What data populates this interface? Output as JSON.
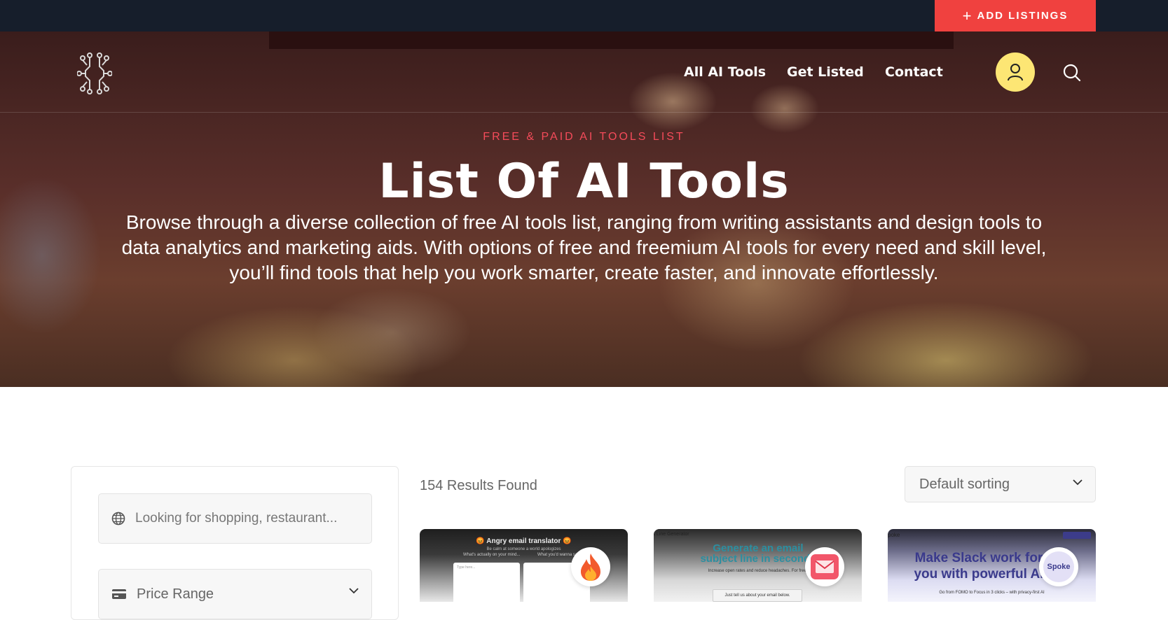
{
  "topbar": {
    "add_listings_label": "ADD LISTINGS"
  },
  "nav": {
    "items": [
      {
        "label": "All AI Tools"
      },
      {
        "label": "Get Listed"
      },
      {
        "label": "Contact"
      }
    ]
  },
  "hero": {
    "eyebrow": "FREE & PAID AI TOOLS LIST",
    "title": "List Of AI Tools",
    "description": "Browse through a diverse collection of free AI tools list, ranging from writing assistants and design tools to data analytics and marketing aids. With options of free and freemium AI tools for every need and skill level, you’ll find tools that help you work smarter, create faster, and innovate effortlessly."
  },
  "filters": {
    "search_placeholder": "Looking for shopping, restaurant...",
    "price_range_label": "Price Range"
  },
  "listing": {
    "results_text": "154 Results Found",
    "sorting_value": "Default sorting"
  },
  "cards": [
    {
      "thumb_title": "😡 Angry email translator 😡",
      "thumb_sub": "Be calm at someone a world apologizes",
      "thumb_left": "What's actually on your mind...",
      "thumb_right": "What you'd wanna say",
      "thumb_input": "Type here...",
      "badge_icon": "fire-icon"
    },
    {
      "thumb_corner": "t Line Generator",
      "thumb_title": "Generate an email subject line in seconds",
      "thumb_sub": "Increase open rates and reduce headaches. For free.",
      "thumb_button": "Just tell us about your email below.",
      "badge_icon": "mail-icon"
    },
    {
      "thumb_corner": "poke",
      "thumb_title": "Make Slack work for you with powerful AI",
      "thumb_sub": "Go from FOMO to Focus in 3 clicks – with privacy-first AI",
      "badge_text": "Spoke",
      "badge_icon": "spoke-logo"
    }
  ],
  "colors": {
    "topbar_bg": "#161e2b",
    "accent_red": "#f0413f",
    "eyebrow_red": "#f54b5a",
    "user_button_yellow": "#fde674"
  }
}
